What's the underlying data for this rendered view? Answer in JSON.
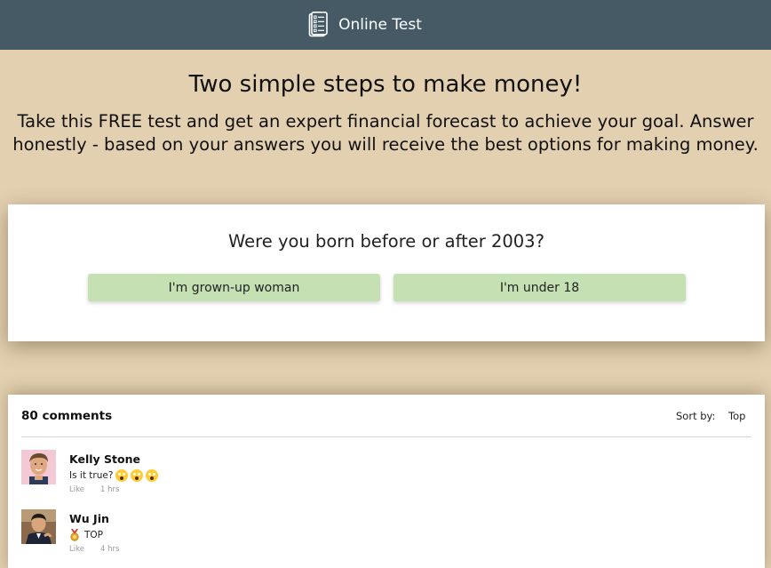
{
  "header": {
    "brand": "Online Test",
    "icon": "survey-clipboard-icon",
    "background": "#465a66"
  },
  "hero": {
    "headline": "Two simple steps to make money!",
    "subhead": "Take this FREE test and get an expert financial forecast to achieve your goal. Answer honestly - based on your answers you will receive the best options for making money."
  },
  "question": {
    "text": "Were you born before or after 2003?",
    "answers": [
      {
        "label": "I'm grown-up woman"
      },
      {
        "label": "I'm under 18"
      }
    ],
    "answer_color": "#c5e1b4"
  },
  "comments": {
    "count_label": "80 comments",
    "sort_label": "Sort by:",
    "sort_value": "Top",
    "items": [
      {
        "author": "Kelly Stone",
        "text": "Is it true?",
        "emojis": [
          "screaming-face-emoji",
          "screaming-face-emoji",
          "screaming-face-emoji"
        ],
        "like": "Like",
        "time": "1 hrs"
      },
      {
        "author": "Wu Jin",
        "text": "TOP",
        "emojis": [
          "medal-emoji"
        ],
        "like": "Like",
        "time": "4 hrs"
      }
    ]
  },
  "colors": {
    "page_background": "#e3d0b1",
    "card": "#ffffff"
  }
}
